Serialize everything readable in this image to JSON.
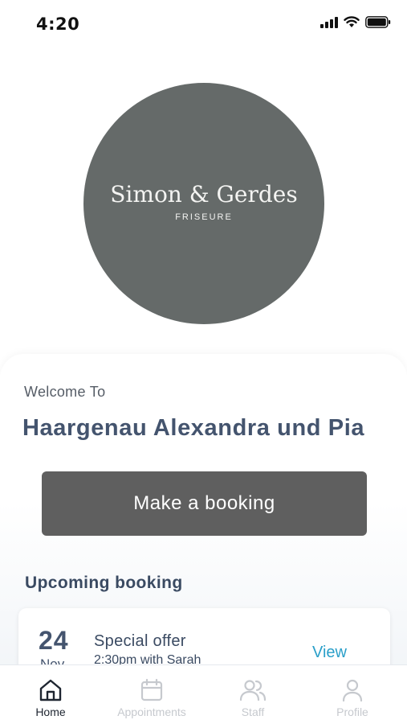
{
  "status": {
    "time": "4:20"
  },
  "logo": {
    "title": "Simon & Gerdes",
    "subtitle": "FRISEURE"
  },
  "welcome": {
    "label": "Welcome To",
    "salon_name": "Haargenau Alexandra und Pia"
  },
  "actions": {
    "booking_button": "Make a booking"
  },
  "upcoming": {
    "heading": "Upcoming booking",
    "booking": {
      "day": "24",
      "month": "Nov",
      "title": "Special offer",
      "details": "2:30pm with Sarah",
      "view_label": "View"
    }
  },
  "tabs": [
    {
      "label": "Home",
      "icon": "home-icon",
      "active": true
    },
    {
      "label": "Appointments",
      "icon": "calendar-icon",
      "active": false
    },
    {
      "label": "Staff",
      "icon": "users-icon",
      "active": false
    },
    {
      "label": "Profile",
      "icon": "user-icon",
      "active": false
    }
  ],
  "colors": {
    "logo_bg": "#656a69",
    "button_bg": "#5f5f5f",
    "heading": "#44546e",
    "link": "#2a9fc9"
  }
}
